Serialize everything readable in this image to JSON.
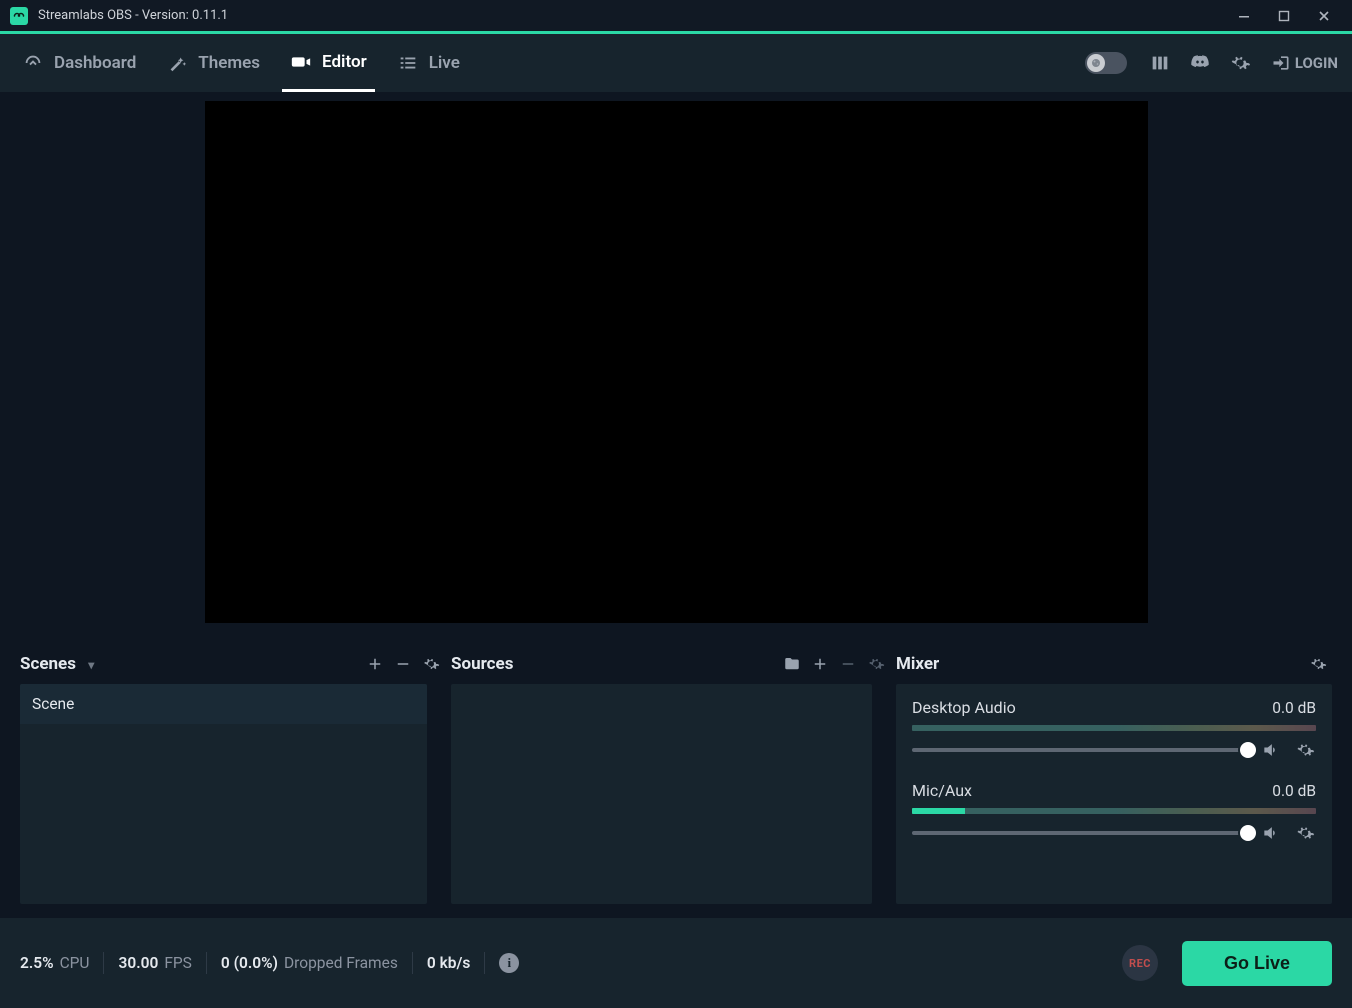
{
  "window": {
    "title": "Streamlabs OBS - Version: 0.11.1"
  },
  "nav": {
    "tabs": [
      {
        "id": "dashboard",
        "label": "Dashboard"
      },
      {
        "id": "themes",
        "label": "Themes"
      },
      {
        "id": "editor",
        "label": "Editor"
      },
      {
        "id": "live",
        "label": "Live"
      }
    ],
    "active": "editor",
    "login_label": "LOGIN"
  },
  "panels": {
    "scenes": {
      "title": "Scenes",
      "items": [
        {
          "name": "Scene"
        }
      ]
    },
    "sources": {
      "title": "Sources",
      "items": []
    },
    "mixer": {
      "title": "Mixer",
      "channels": [
        {
          "name": "Desktop Audio",
          "db": "0.0 dB",
          "level_pct": 0,
          "slider_pct": 100
        },
        {
          "name": "Mic/Aux",
          "db": "0.0 dB",
          "level_pct": 13,
          "slider_pct": 100
        }
      ]
    }
  },
  "status": {
    "cpu_value": "2.5%",
    "cpu_label": "CPU",
    "fps_value": "30.00",
    "fps_label": "FPS",
    "dropped_value": "0 (0.0%)",
    "dropped_label": "Dropped Frames",
    "bitrate_value": "0 kb/s",
    "rec_label": "REC",
    "golive_label": "Go Live"
  }
}
